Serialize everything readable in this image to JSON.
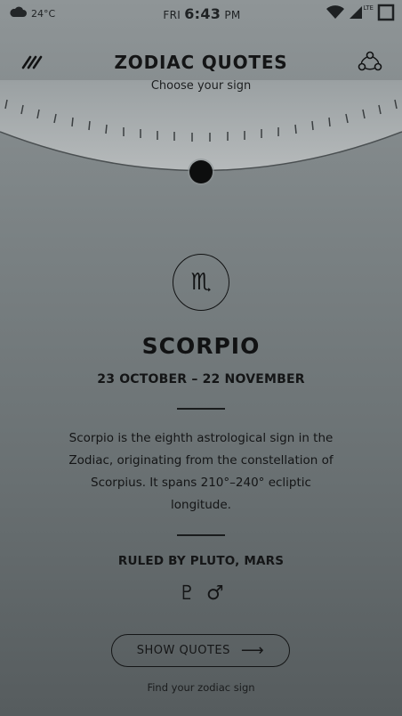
{
  "status_bar": {
    "weather_icon": "cloud-icon",
    "temperature": "24°C",
    "day": "FRI",
    "time": "6:43",
    "ampm": "PM",
    "network_label": "LTE",
    "icons": [
      "wifi-icon",
      "signal-icon",
      "recents-icon"
    ]
  },
  "header": {
    "title": "ZODIAC QUOTES",
    "subtitle": "Choose your sign",
    "menu_icon": "menu-icon",
    "share_icon": "share-icon"
  },
  "sign": {
    "symbol": "♏",
    "name": "SCORPIO",
    "dates": "23 OCTOBER – 22 NOVEMBER",
    "description": "Scorpio is the eighth astrological sign in the Zodiac, originating from the constellation of Scorpius. It spans 210°–240° ecliptic longitude.",
    "ruled_by": "RULED BY PLUTO, MARS",
    "planet_symbols": [
      "♇",
      "♂"
    ]
  },
  "actions": {
    "show_quotes_label": "SHOW QUOTES",
    "arrow": "⟶",
    "footer_hint": "Find your zodiac sign"
  },
  "colors": {
    "background_top": "#8f9597",
    "background_bottom": "#565c5e",
    "dial": "#a7acae",
    "text": "#141516"
  }
}
